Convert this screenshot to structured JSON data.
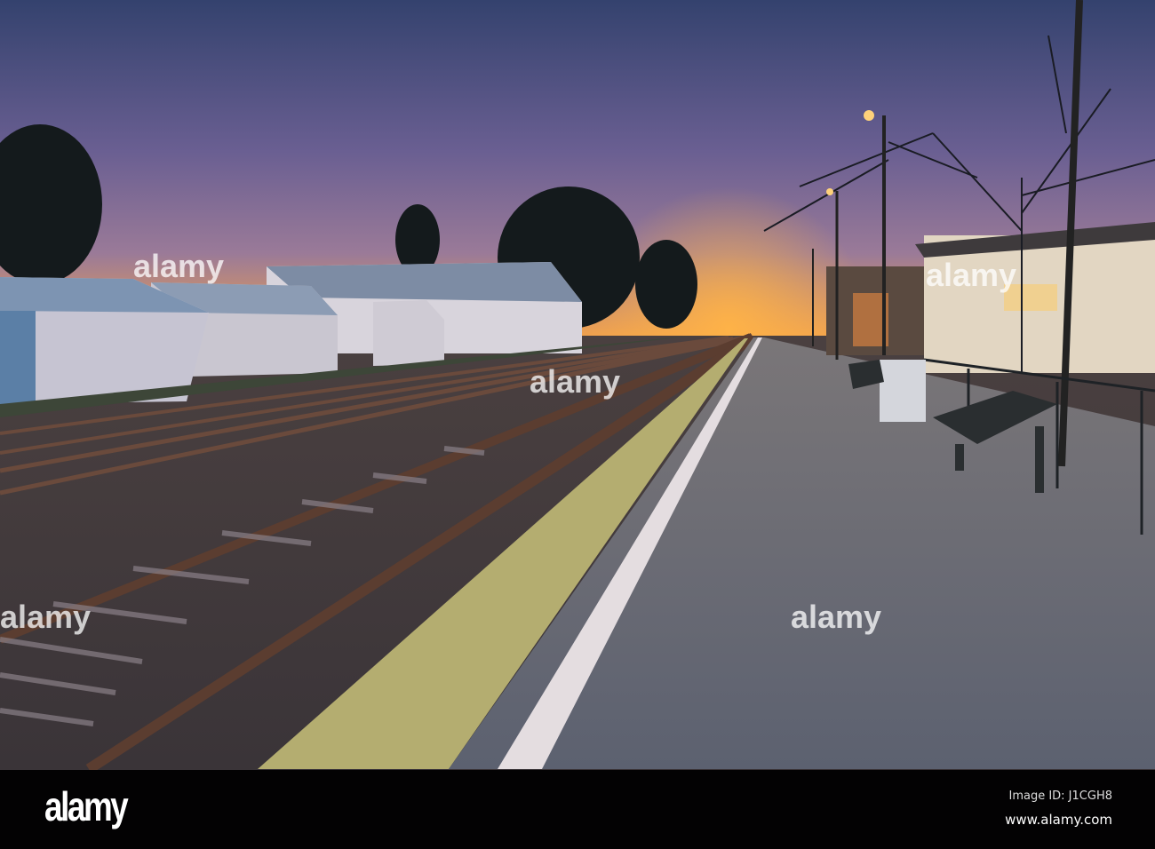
{
  "photo": {
    "subject": "Railway station platform at dawn",
    "watermark_text": "alamy",
    "colors": {
      "sky_top": "#3a4a7a",
      "sky_horizon": "#f0a050",
      "platform": "#6f7178",
      "tactile_strip": "#b8b070"
    }
  },
  "footer": {
    "logo": "alamy",
    "image_id": "Image ID: J1CGH8",
    "website": "www.alamy.com"
  }
}
